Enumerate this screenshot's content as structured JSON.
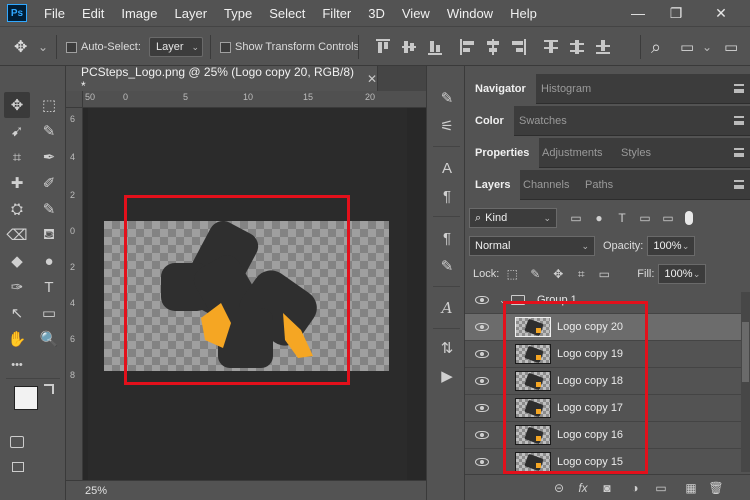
{
  "app": {
    "logo": "Ps"
  },
  "menu": [
    "File",
    "Edit",
    "Image",
    "Layer",
    "Type",
    "Select",
    "Filter",
    "3D",
    "View",
    "Window",
    "Help"
  ],
  "window_controls": {
    "minimize": "—",
    "restore": "❐",
    "close": "✕"
  },
  "options_bar": {
    "move_icon": "✥",
    "dropdown_arrow": "⌄",
    "auto_select_label": "Auto-Select:",
    "auto_select_target": "Layer",
    "show_transform_label": "Show Transform Controls",
    "search_icon": "⌕",
    "workspace_icon": "▭",
    "workspace_arrow": "⌄"
  },
  "document": {
    "tab_title": "PCSteps_Logo.png @ 25% (Logo copy 20, RGB/8) *",
    "close_glyph": "✕",
    "zoom": "25%",
    "ruler_h": [
      "50",
      "0",
      "5",
      "10",
      "15",
      "20"
    ],
    "ruler_v": [
      "6",
      "4",
      "2",
      "0",
      "2",
      "4",
      "6",
      "8"
    ]
  },
  "tools": [
    "✥",
    "⬚",
    "➹",
    "✎",
    "⌗",
    "✒",
    "✚",
    "✐",
    "⛭",
    "✎",
    "⌫",
    "⛾",
    "◆",
    "●",
    "✑",
    "T",
    "↖",
    "▭",
    "✋",
    "🔍",
    "•••"
  ],
  "dock_icons": [
    "✎",
    "⚟",
    "A",
    "¶",
    "¶",
    "✎",
    "A",
    "⇅",
    "▶"
  ],
  "panels": {
    "navigator_tabs": [
      "Navigator",
      "Histogram"
    ],
    "color_tabs": [
      "Color",
      "Swatches"
    ],
    "properties_tabs": [
      "Properties",
      "Adjustments",
      "Styles"
    ],
    "layers_tabs": [
      "Layers",
      "Channels",
      "Paths"
    ]
  },
  "layers_panel": {
    "filter_kind": "Kind",
    "blend_mode": "Normal",
    "opacity_label": "Opacity:",
    "opacity_value": "100%",
    "lock_label": "Lock:",
    "fill_label": "Fill:",
    "fill_value": "100%",
    "group_name": "Group 1",
    "layers": [
      {
        "name": "Logo copy 20",
        "selected": true
      },
      {
        "name": "Logo copy 19",
        "selected": false
      },
      {
        "name": "Logo copy 18",
        "selected": false
      },
      {
        "name": "Logo copy 17",
        "selected": false
      },
      {
        "name": "Logo copy 16",
        "selected": false
      },
      {
        "name": "Logo copy 15",
        "selected": false
      }
    ],
    "bottom_icons": [
      "⊝",
      "fx",
      "◙",
      "◑",
      "▭",
      "▦",
      "🗑"
    ]
  },
  "colors": {
    "highlight": "#e3101b",
    "logo_dark": "#2f2f2f",
    "logo_orange": "#f5a623"
  }
}
